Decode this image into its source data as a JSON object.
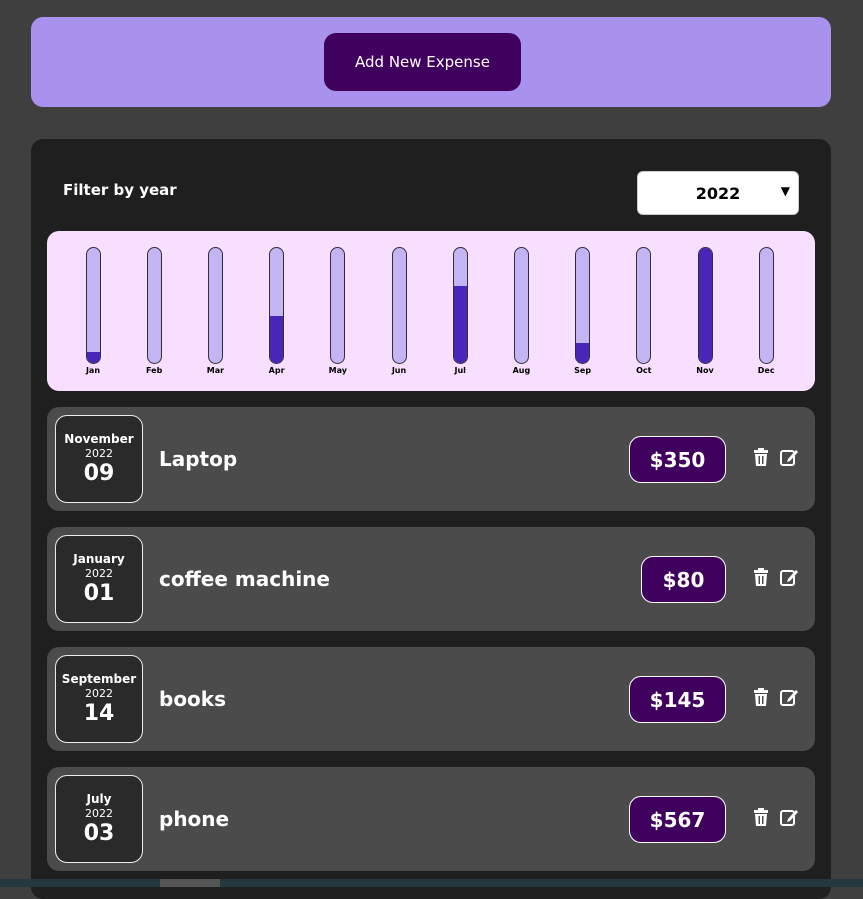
{
  "header": {
    "add_button_label": "Add New Expense"
  },
  "filter": {
    "label": "Filter by year",
    "selected_year": "2022"
  },
  "chart_data": {
    "type": "bar",
    "categories": [
      "Jan",
      "Feb",
      "Mar",
      "Apr",
      "May",
      "Jun",
      "Jul",
      "Aug",
      "Sep",
      "Oct",
      "Nov",
      "Dec"
    ],
    "values": [
      80,
      0,
      0,
      350,
      0,
      0,
      567,
      0,
      145,
      0,
      850,
      0
    ],
    "max": 567
  },
  "expenses": [
    {
      "month": "November",
      "year": "2022",
      "day": "09",
      "title": "Laptop",
      "amount": "$350"
    },
    {
      "month": "January",
      "year": "2022",
      "day": "01",
      "title": "coffee machine",
      "amount": "$80"
    },
    {
      "month": "September",
      "year": "2022",
      "day": "14",
      "title": "books",
      "amount": "$145"
    },
    {
      "month": "July",
      "year": "2022",
      "day": "03",
      "title": "phone",
      "amount": "$567"
    }
  ],
  "icons": {
    "delete": "trash-icon",
    "edit": "edit-icon"
  },
  "colors": {
    "accent": "#40005d",
    "panel": "#a892ee",
    "chart_bg": "#f8dfff",
    "bar_fill": "#4826b9",
    "bar_track": "#c3b4f3"
  }
}
